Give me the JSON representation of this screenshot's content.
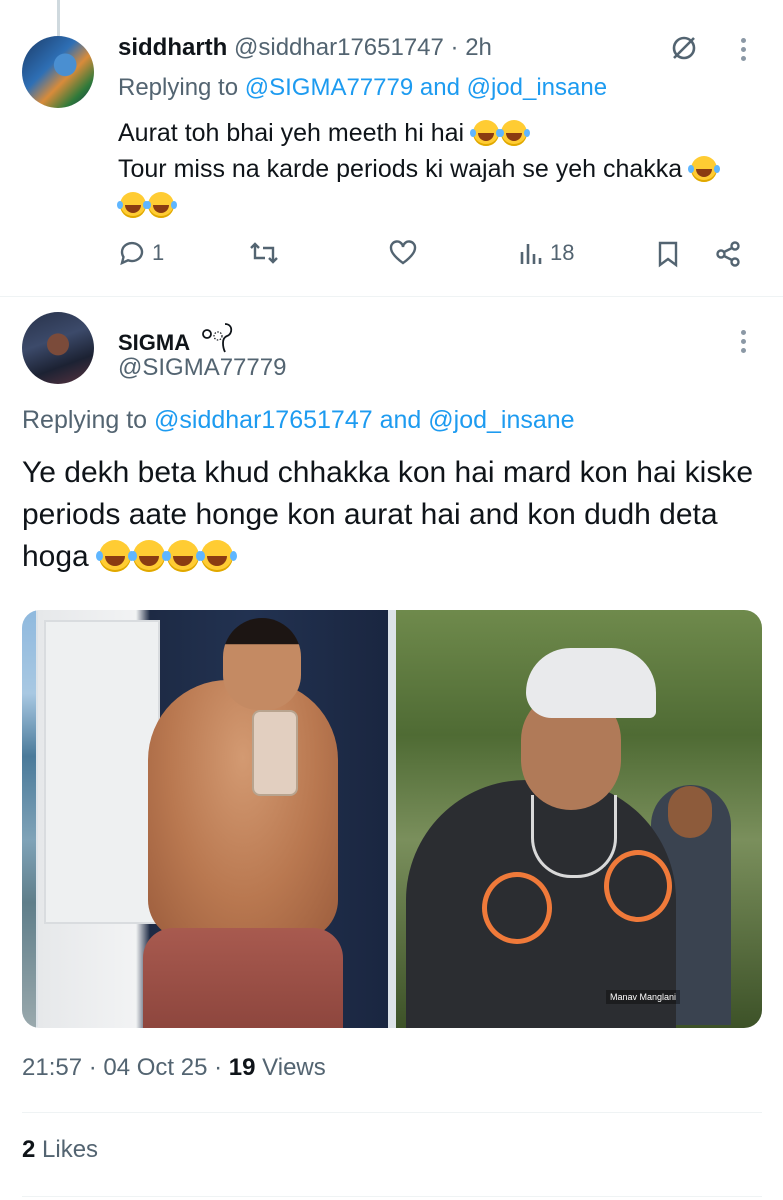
{
  "reply_tweet": {
    "author_name": "siddharth",
    "author_handle": "@siddhar17651747",
    "time": "· 2h",
    "replying_prefix": "Replying to",
    "replying_to_1": "@SIGMA77779",
    "replying_and": "and",
    "replying_to_2": "@jod_insane",
    "text_line1": "Aurat toh bhai yeh meeth hi hai",
    "text_line2": "Tour miss na karde periods ki wajah se yeh chakka",
    "emoji_name": "face-with-tears-of-joy",
    "reply_count": "1",
    "views_count": "18"
  },
  "main_tweet": {
    "author_name": "SIGMA",
    "author_handle": "@SIGMA77779",
    "replying_prefix": "Replying to",
    "replying_to_1": "@siddhar17651747",
    "replying_and": "and",
    "replying_to_2": "@jod_insane",
    "text": "Ye dekh beta khud chhakka kon hai mard kon hai kiske periods aate honge kon aurat hai and kon dudh deta hoga",
    "emoji_name": "rolling-on-the-floor-laughing",
    "media_watermark": "Manav Manglani",
    "time": "21:57",
    "date": "04 Oct 25",
    "views_count": "19",
    "views_label": "Views",
    "likes_count": "2",
    "likes_label": "Likes"
  },
  "colors": {
    "link": "#1d9bf0",
    "muted": "#536471",
    "text": "#0f1419",
    "annotation_circle": "#f07a3a"
  }
}
